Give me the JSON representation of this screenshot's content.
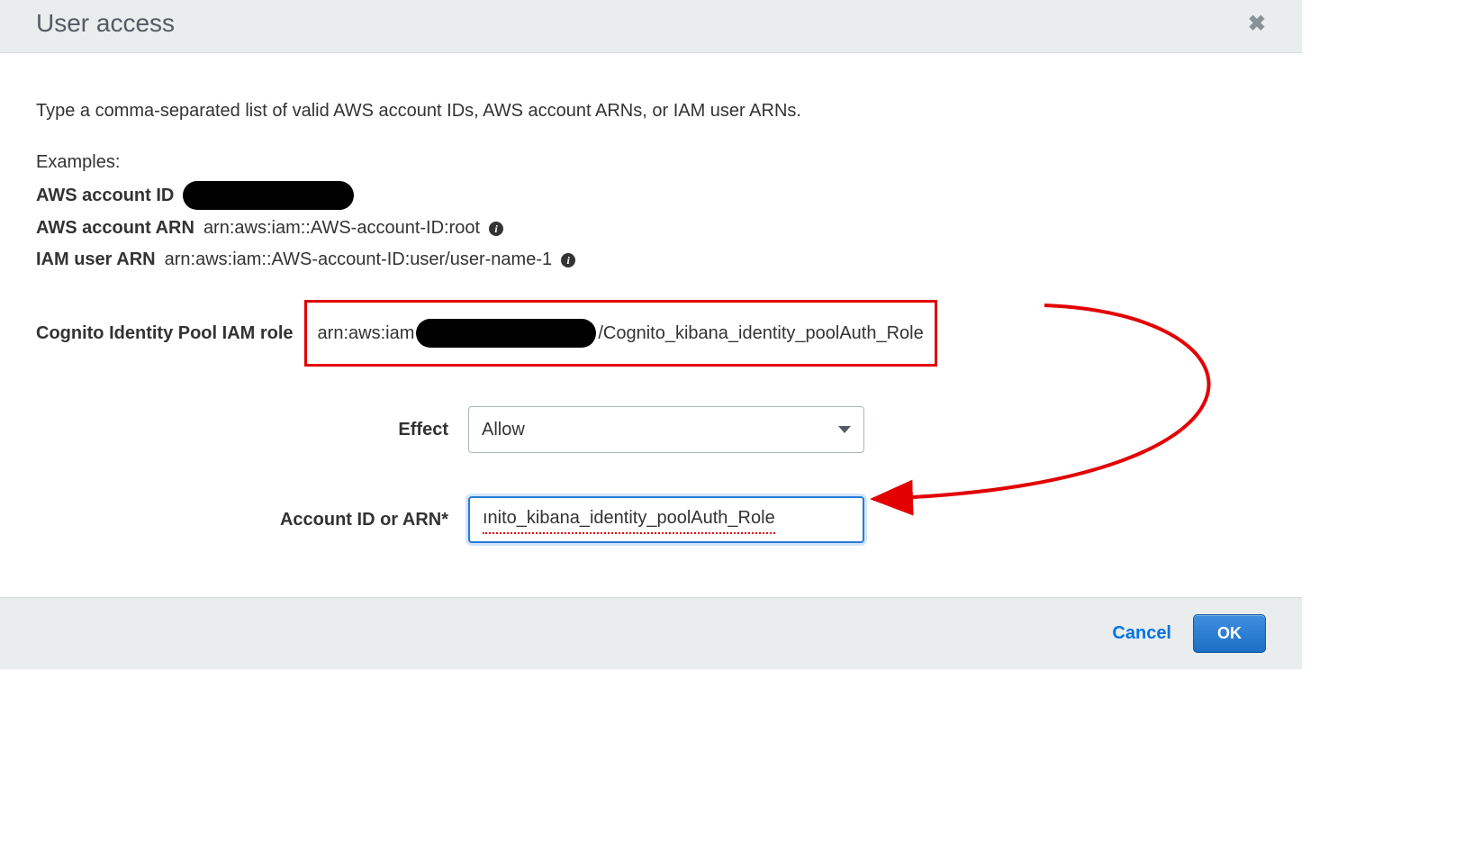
{
  "dialog": {
    "title": "User access",
    "intro": "Type a comma-separated list of valid AWS account IDs, AWS account ARNs, or IAM user ARNs.",
    "examples_heading": "Examples:",
    "examples": {
      "aws_account_id_label": "AWS account ID",
      "aws_account_arn_label": "AWS account ARN",
      "aws_account_arn_value": "arn:aws:iam::AWS-account-ID:root",
      "iam_user_arn_label": "IAM user ARN",
      "iam_user_arn_value": "arn:aws:iam::AWS-account-ID:user/user-name-1"
    },
    "cognito": {
      "label": "Cognito Identity Pool IAM role",
      "value_prefix": "arn:aws:iam",
      "value_suffix": "/Cognito_kibana_identity_poolAuth_Role"
    },
    "form": {
      "effect_label": "Effect",
      "effect_value": "Allow",
      "account_label": "Account ID or ARN*",
      "account_value": "ınito_kibana_identity_poolAuth_Role"
    },
    "footer": {
      "cancel": "Cancel",
      "ok": "OK"
    }
  },
  "annotation": {
    "color": "#e30000"
  }
}
